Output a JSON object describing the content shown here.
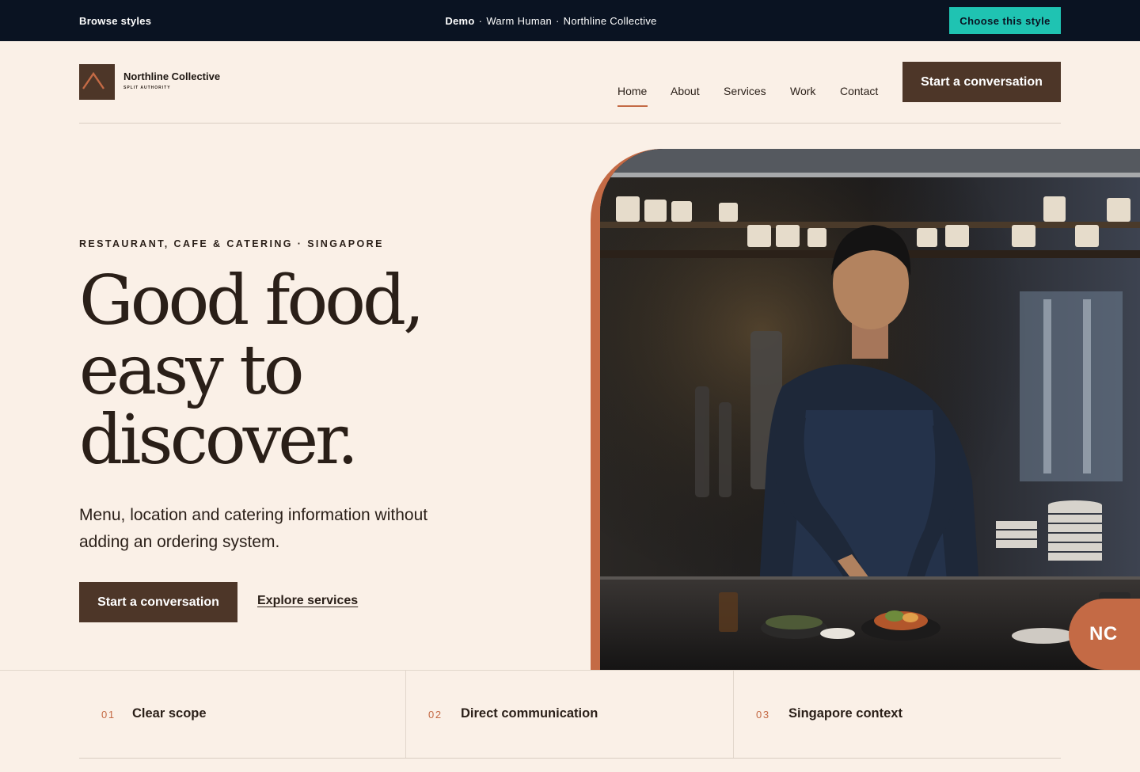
{
  "demo_bar": {
    "browse_label": "Browse styles",
    "demo_label": "Demo",
    "style_name": "Warm Human",
    "site_name": "Northline Collective",
    "separator": "·",
    "choose_label": "Choose this style"
  },
  "header": {
    "brand_name": "Northline Collective",
    "brand_tagline": "SPLIT AUTHORITY",
    "nav": [
      "Home",
      "About",
      "Services",
      "Work",
      "Contact"
    ],
    "active_nav": "Home",
    "cta_label": "Start a conversation"
  },
  "hero": {
    "eyebrow": "RESTAURANT, CAFE & CATERING · SINGAPORE",
    "headline": [
      "Good food,",
      "easy to",
      "discover."
    ],
    "lede": "Menu, location and catering information without adding an ordering system.",
    "primary_cta": "Start a conversation",
    "secondary_cta": "Explore services",
    "badge": "NC"
  },
  "features": [
    {
      "num": "01",
      "title": "Clear scope"
    },
    {
      "num": "02",
      "title": "Direct communication"
    },
    {
      "num": "03",
      "title": "Singapore context"
    }
  ],
  "colors": {
    "background": "#FAF0E7",
    "dark_brown": "#4D3628",
    "accent": "#C46A45",
    "demo_bar": "#0A1322",
    "teal": "#1FC3B2"
  }
}
